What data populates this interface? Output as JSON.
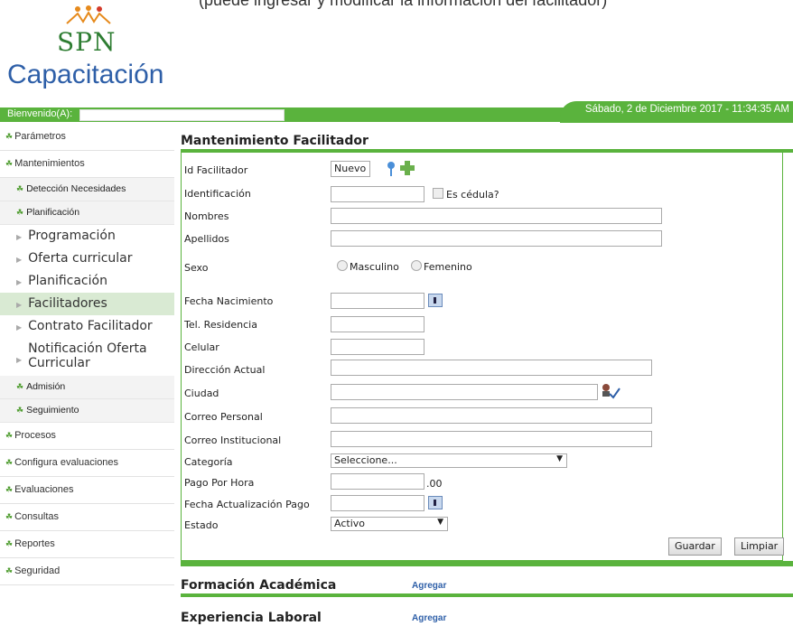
{
  "header": {
    "logo_text": "SPN",
    "app_title": "Capacitación",
    "welcome": "Bienvenido(A):",
    "datetime": "Sábado, 2 de Diciembre 2017 - 11:34:35 AM",
    "cut_text": "(puede ingresar y modificar la información del facilitador)"
  },
  "sidebar": {
    "parametros": "Parámetros",
    "mantenimientos": "Mantenimientos",
    "deteccion": "Detección Necesidades",
    "planificacion_group": "Planificación",
    "programacion": "Programación",
    "oferta": "Oferta curricular",
    "planificacion": "Planificación",
    "facilitadores": "Facilitadores",
    "contrato": "Contrato Facilitador",
    "notificacion": "Notificación Oferta Curricular",
    "admision": "Admisión",
    "seguimiento": "Seguimiento",
    "procesos": "Procesos",
    "configura": "Configura evaluaciones",
    "evaluaciones": "Evaluaciones",
    "consultas": "Consultas",
    "reportes": "Reportes",
    "seguridad": "Seguridad"
  },
  "form": {
    "title": "Mantenimiento Facilitador",
    "id_label": "Id Facilitador",
    "id_value": "Nuevo",
    "identificacion_label": "Identificación",
    "es_cedula": "Es cédula?",
    "nombres_label": "Nombres",
    "apellidos_label": "Apellidos",
    "sexo_label": "Sexo",
    "masculino": "Masculino",
    "femenino": "Femenino",
    "fecha_nac_label": "Fecha Nacimiento",
    "tel_label": "Tel. Residencia",
    "celular_label": "Celular",
    "direccion_label": "Dirección Actual",
    "ciudad_label": "Ciudad",
    "correo_personal_label": "Correo Personal",
    "correo_inst_label": "Correo Institucional",
    "categoria_label": "Categoría",
    "categoria_value": "Seleccione...",
    "pago_label": "Pago Por Hora",
    "pago_suffix": ".00",
    "fecha_pago_label": "Fecha Actualización Pago",
    "estado_label": "Estado",
    "estado_value": "Activo",
    "guardar": "Guardar",
    "limpiar": "Limpiar"
  },
  "sections": {
    "formacion": "Formación Académica",
    "experiencia": "Experiencia Laboral",
    "agregar": "Agregar"
  }
}
